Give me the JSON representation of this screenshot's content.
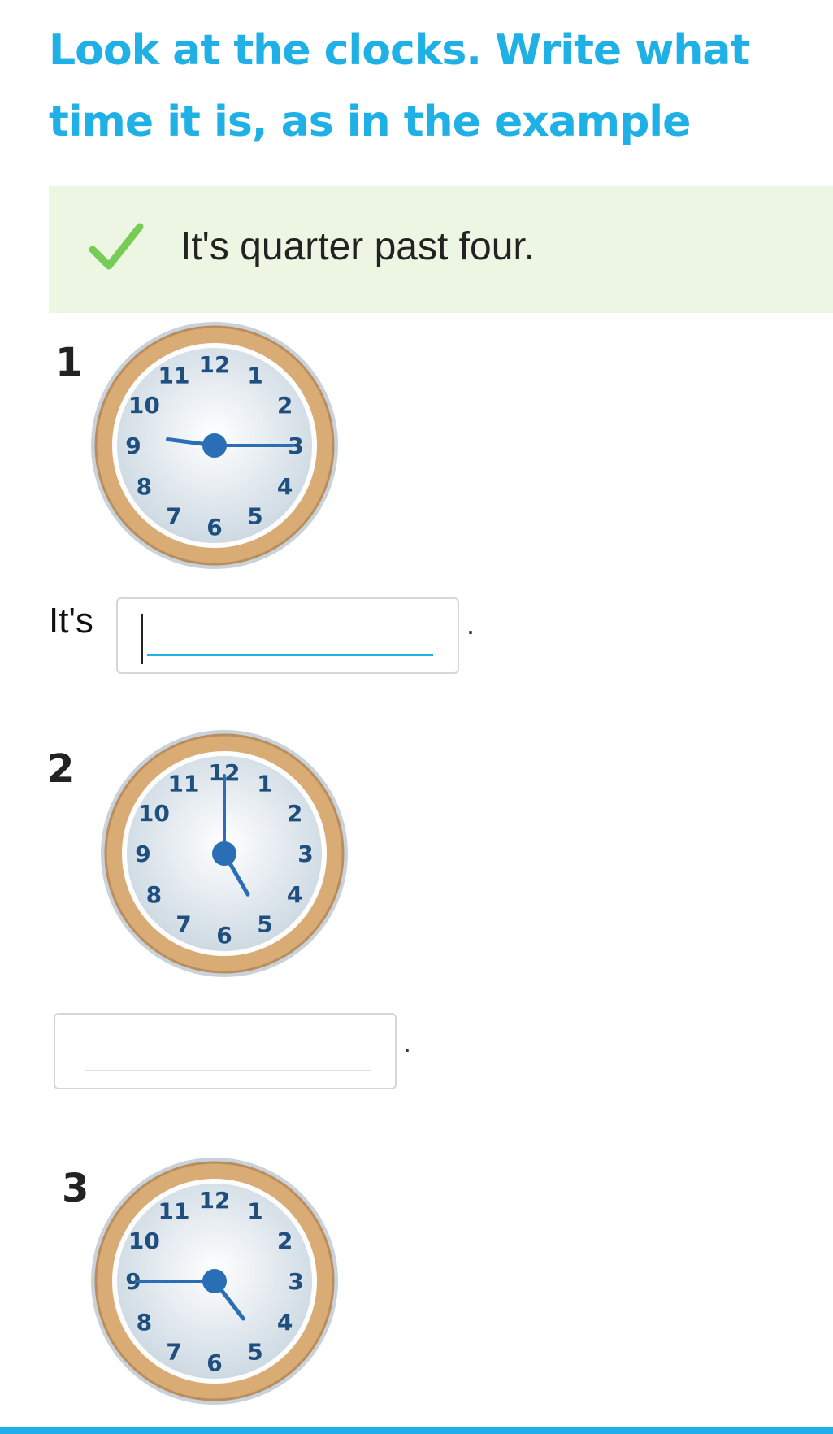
{
  "title": "Look at the clocks. Write what time it is, as in the example",
  "example": {
    "text": "It's quarter past four.",
    "icon": "check-icon",
    "check_color": "#77cc55"
  },
  "items": [
    {
      "number": "1",
      "prefix": "It's",
      "answer_value": "",
      "clock_time": "9:15",
      "active": true
    },
    {
      "number": "2",
      "prefix": "",
      "answer_value": "",
      "clock_time": "5:00",
      "active": false
    },
    {
      "number": "3",
      "prefix": "",
      "answer_value": "",
      "clock_time": "4:45",
      "active": false
    }
  ],
  "sentence_end": ".",
  "clock_numerals": [
    "12",
    "1",
    "2",
    "3",
    "4",
    "5",
    "6",
    "7",
    "8",
    "9",
    "10",
    "11"
  ],
  "colors": {
    "accent": "#1fb0e6",
    "clock_hand": "#2a6fb5",
    "clock_rim": "#d9ab75",
    "example_bg": "#edf5e3"
  }
}
